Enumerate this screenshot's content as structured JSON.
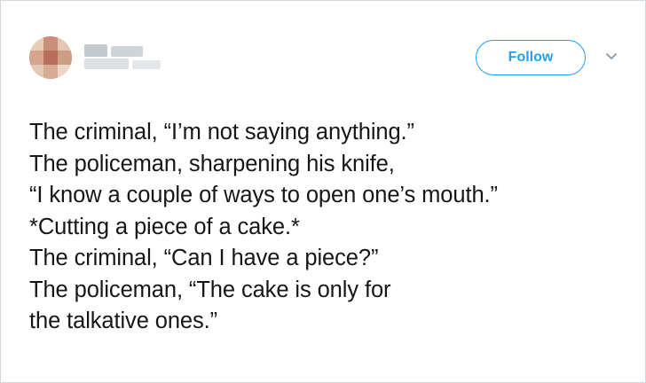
{
  "tweet": {
    "follow_label": "Follow",
    "lines": [
      "The criminal, “I’m not saying anything.”",
      "The policeman, sharpening his knife,",
      "“I know a couple of ways to open one’s mouth.”",
      "*Cutting a piece of a cake.*",
      "The criminal, “Can I have a piece?”",
      "The policeman, “The cake is only for",
      "the talkative ones.”"
    ]
  },
  "colors": {
    "accent": "#1da1f2",
    "text": "#14171a",
    "border": "#cfd9de"
  },
  "icons": {
    "menu": "chevron-down-icon"
  }
}
